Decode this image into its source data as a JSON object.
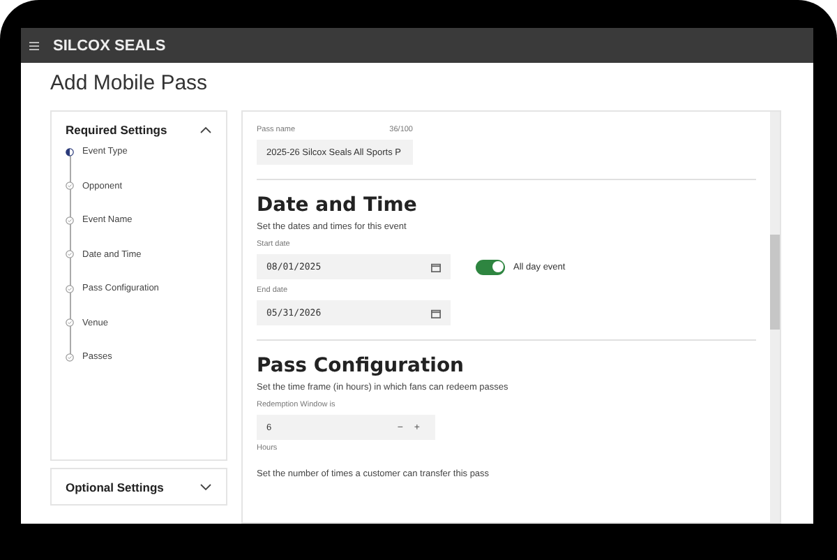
{
  "app_bar": {
    "brand": "SILCOX SEALS"
  },
  "page_title": "Add Mobile Pass",
  "required_settings": {
    "title": "Required Settings",
    "expanded": true,
    "steps": [
      {
        "label": "Event Type",
        "selected": true
      },
      {
        "label": "Opponent",
        "selected": false
      },
      {
        "label": "Event Name",
        "selected": false
      },
      {
        "label": "Date and Time",
        "selected": false
      },
      {
        "label": "Pass Configuration",
        "selected": false
      },
      {
        "label": "Venue",
        "selected": false
      },
      {
        "label": "Passes",
        "selected": false
      }
    ]
  },
  "optional_settings": {
    "title": "Optional Settings",
    "expanded": false
  },
  "pass_name": {
    "label": "Pass name",
    "counter": "36/100",
    "value": "2025-26 Silcox Seals All Sports P"
  },
  "date_and_time": {
    "heading": "Date and Time",
    "description": "Set the dates and times for this event",
    "start_label": "Start date",
    "start_value": "08/01/2025",
    "end_label": "End date",
    "end_value": "05/31/2026",
    "all_day": {
      "label": "All day event",
      "on": true
    }
  },
  "pass_configuration": {
    "heading": "Pass Configuration",
    "description": "Set the time frame (in hours) in which fans can redeem passes",
    "redemption_label": "Redemption Window is",
    "redemption_value": "6",
    "decrement": "−",
    "increment": "+",
    "unit": "Hours",
    "transfer_description": "Set the number of times a customer can transfer this pass"
  }
}
